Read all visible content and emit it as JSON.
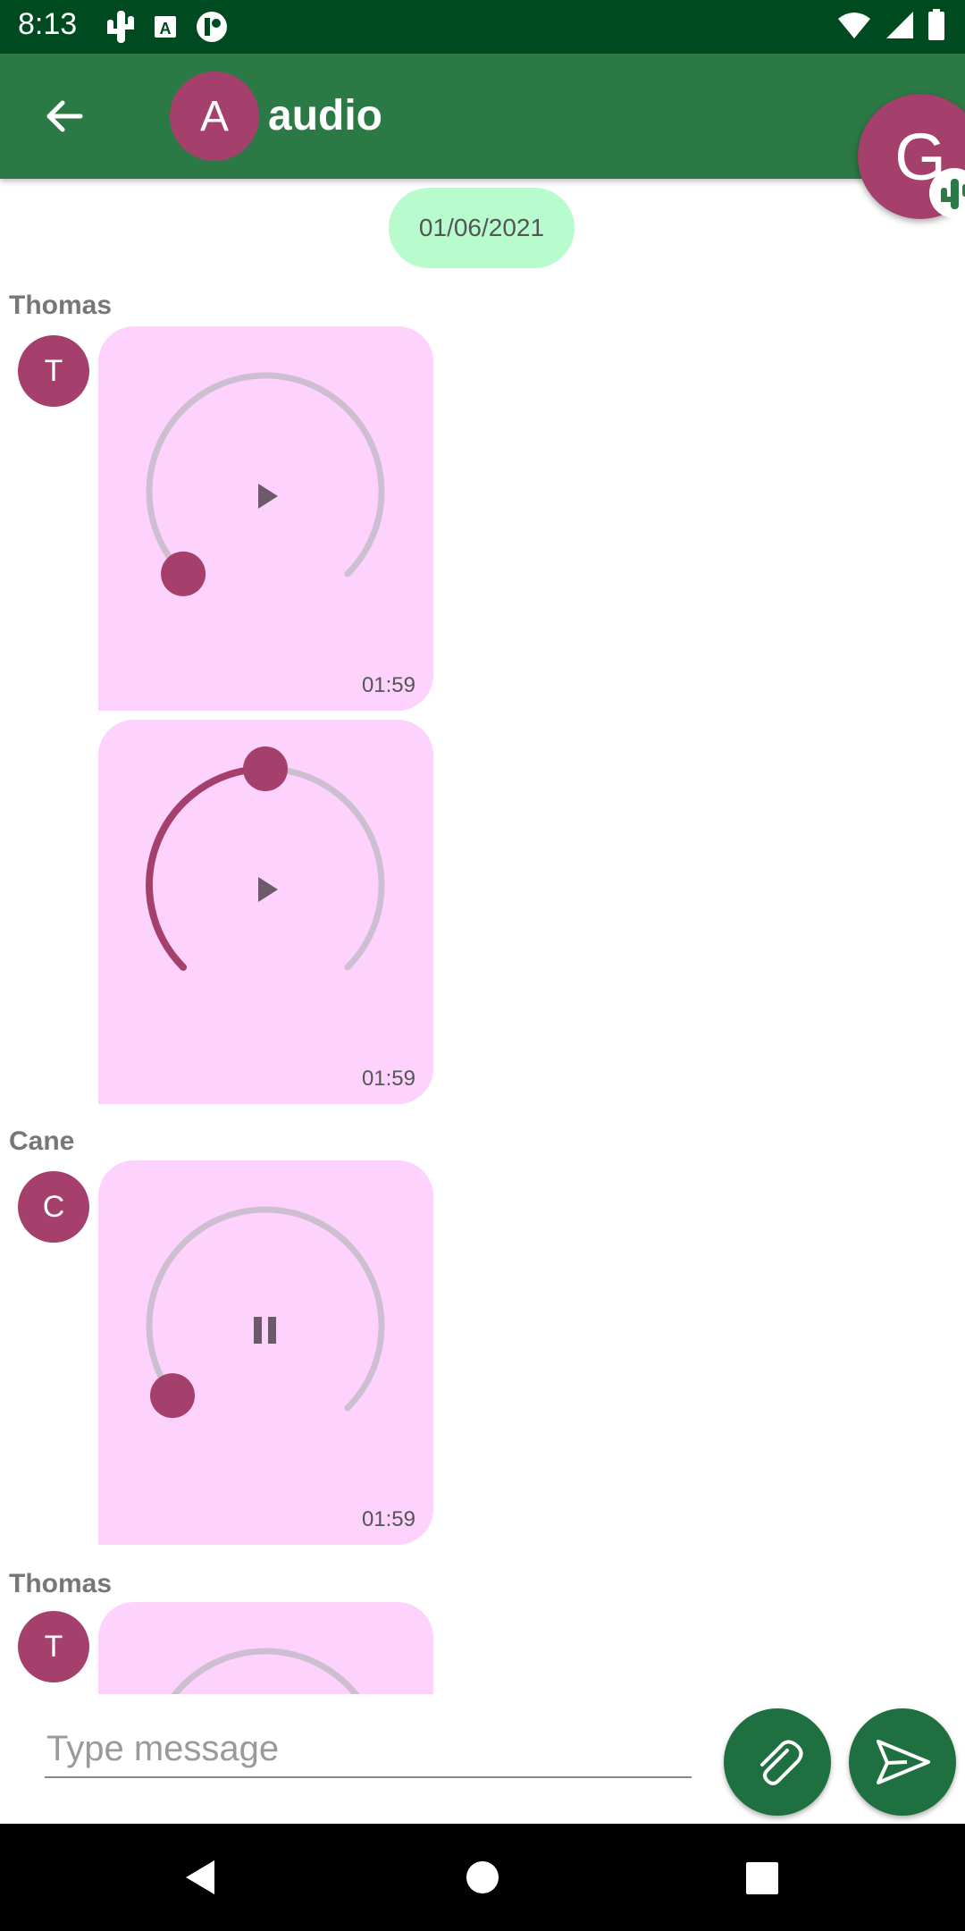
{
  "status_bar": {
    "time": "8:13"
  },
  "header": {
    "chat_avatar_letter": "A",
    "title": "audio",
    "profile_letter": "G"
  },
  "date_chip": "01/06/2021",
  "messages": [
    {
      "sender": "Thomas",
      "avatar_letter": "T",
      "duration": "01:59",
      "state": "play",
      "progress": 0.0
    },
    {
      "sender": "",
      "avatar_letter": "",
      "duration": "01:59",
      "state": "play",
      "progress": 0.5
    },
    {
      "sender": "Cane",
      "avatar_letter": "C",
      "duration": "01:59",
      "state": "pause",
      "progress": 0.03
    },
    {
      "sender": "Thomas",
      "avatar_letter": "T",
      "duration": "",
      "state": "play",
      "progress": 0.0
    }
  ],
  "composer": {
    "placeholder": "Type message"
  },
  "colors": {
    "status_bar": "#004a1f",
    "app_bar": "#2b7a45",
    "accent": "#a53f6c",
    "bubble": "#fdd3fe",
    "date_chip": "#b8fbcc",
    "fab": "#1e7040"
  },
  "icons": {
    "back": "arrow-left-icon",
    "attach": "paperclip-icon",
    "send": "send-icon",
    "nav": [
      "back-triangle-icon",
      "home-circle-icon",
      "recents-square-icon"
    ]
  }
}
